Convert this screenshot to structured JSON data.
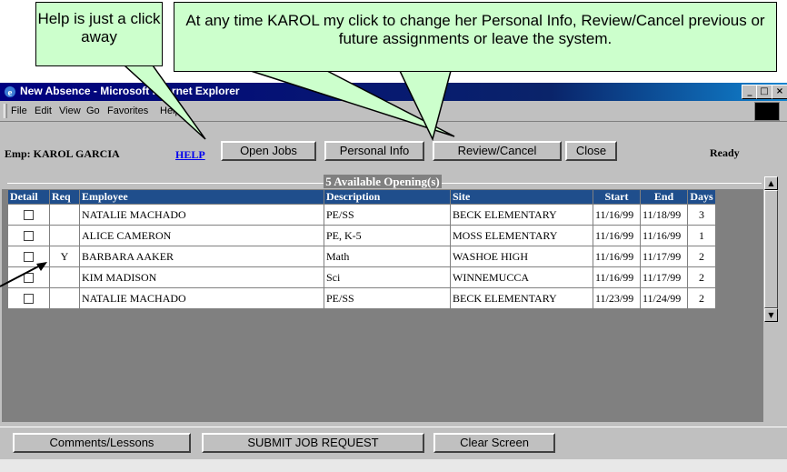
{
  "window": {
    "title": "New Absence - Microsoft Internet Explorer",
    "controls": [
      "_",
      "□",
      "×"
    ],
    "icon": "ie-icon"
  },
  "menu": [
    "File",
    "Edit",
    "View",
    "Go",
    "Favorites",
    "Help"
  ],
  "header": {
    "employee": "Emp: KAROL GARCIA",
    "help_link": "HELP",
    "buttons": [
      "Open Jobs",
      "Personal Info",
      "Review/Cancel",
      "Close"
    ],
    "status": "Ready"
  },
  "grid": {
    "title": "5 Available Opening(s)",
    "columns": [
      "Detail",
      "Req",
      "Employee",
      "Description",
      "Site",
      "Start",
      "End",
      "Days"
    ],
    "rows": [
      {
        "req": "",
        "employee": "NATALIE MACHADO",
        "description": "PE/SS",
        "site": "BECK ELEMENTARY",
        "start": "11/16/99",
        "end": "11/18/99",
        "days": "3"
      },
      {
        "req": "",
        "employee": "ALICE CAMERON",
        "description": "PE, K-5",
        "site": "MOSS ELEMENTARY",
        "start": "11/16/99",
        "end": "11/16/99",
        "days": "1"
      },
      {
        "req": "Y",
        "employee": "BARBARA AAKER",
        "description": "Math",
        "site": "WASHOE HIGH",
        "start": "11/16/99",
        "end": "11/17/99",
        "days": "2"
      },
      {
        "req": "",
        "employee": "KIM MADISON",
        "description": "Sci",
        "site": "WINNEMUCCA",
        "start": "11/16/99",
        "end": "11/17/99",
        "days": "2"
      },
      {
        "req": "",
        "employee": "NATALIE MACHADO",
        "description": "PE/SS",
        "site": "BECK ELEMENTARY",
        "start": "11/23/99",
        "end": "11/24/99",
        "days": "2"
      }
    ]
  },
  "footer": {
    "buttons": [
      "Comments/Lessons",
      "SUBMIT JOB REQUEST",
      "Clear Screen"
    ]
  },
  "callouts": {
    "help": "Help is just a click away",
    "personal": "At any time KAROL my click to change her Personal Info, Review/Cancel previous or future assignments or leave the system.",
    "color": "#ccffcc"
  },
  "colors": {
    "titlebar": "#000080",
    "grid_header": "#1f4e8c",
    "link": "#0000ee"
  }
}
